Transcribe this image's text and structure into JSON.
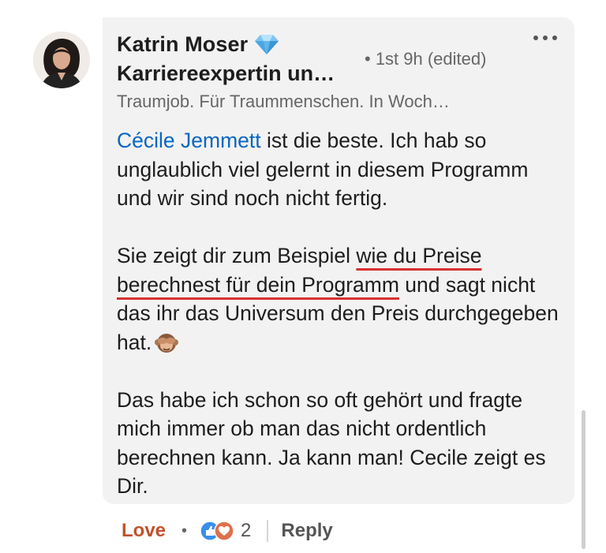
{
  "author": {
    "name": "Katrin Moser",
    "headline": "Karriereexpertin un…",
    "subtitle": "Traumjob. Für Traummenschen. In Woch…",
    "meta": "• 1st  9h (edited)",
    "verified_icon": "diamond-icon",
    "avatar": "profile-photo"
  },
  "comment": {
    "p1_mention": "Cécile Jemmett",
    "p1_rest": " ist die beste. Ich hab so unglaublich viel gelernt in diesem Programm und wir sind noch nicht fertig.",
    "p2_before": "Sie zeigt dir zum Beispiel ",
    "p2_hl1": "wie du Preise",
    "p2_space": " ",
    "p2_hl2": "berechnest für dein Programm",
    "p2_after": " und sagt nicht das ihr das Universum den Preis durchgegeben hat.",
    "p2_emoji": "see-no-evil-monkey-icon",
    "p3": "Das habe ich schon so oft gehört und fragte mich immer ob man das nicht ordentlich berechnen kann. Ja kann man! Cecile zeigt es Dir."
  },
  "actions": {
    "love_label": "Love",
    "separator": "•",
    "reaction_count": "2",
    "reply_label": "Reply",
    "reaction_icons": [
      "like-icon",
      "love-icon"
    ]
  },
  "colors": {
    "bubble": "#f2f2f2",
    "mention": "#0a66c2",
    "love": "#c2512b",
    "highlight_underline": "#d93030"
  }
}
